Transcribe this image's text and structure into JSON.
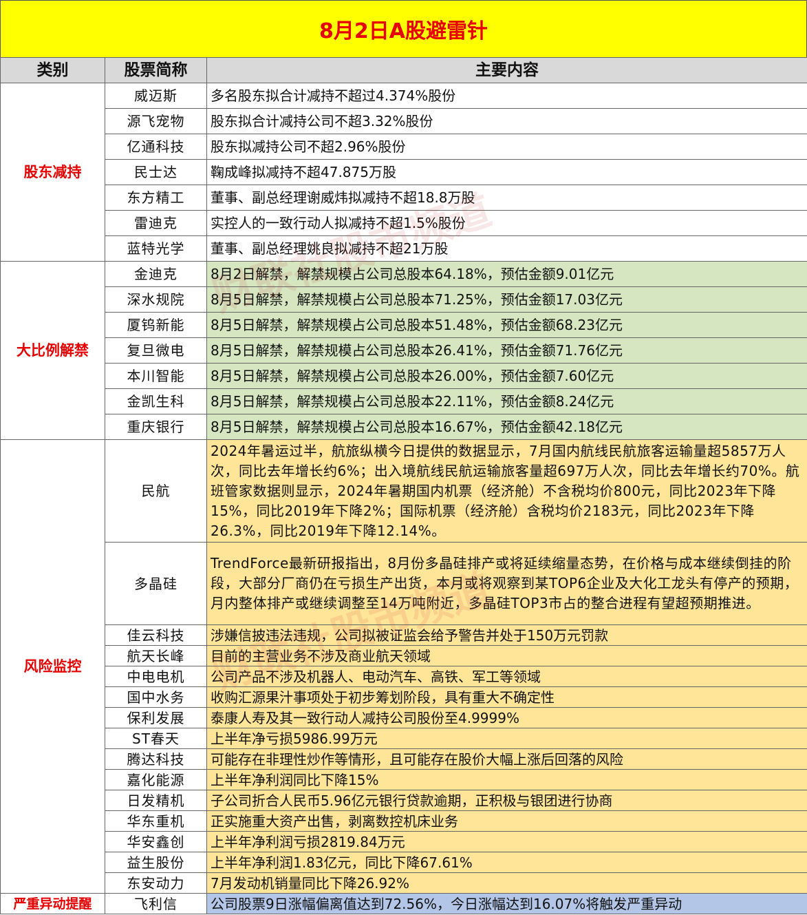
{
  "title": "8月2日A股避雷针",
  "headers": {
    "category": "类别",
    "stock": "股票简称",
    "content": "主要内容"
  },
  "watermark": "财联社股市频道",
  "sections": [
    {
      "category": "股东减持",
      "rows": [
        {
          "stock": "威迈斯",
          "content": "多名股东拟合计减持不超过4.374%股份"
        },
        {
          "stock": "源飞宠物",
          "content": "股东拟合计减持公司不超3.32%股份"
        },
        {
          "stock": "亿通科技",
          "content": "股东拟减持公司不超2.96%股份"
        },
        {
          "stock": "民士达",
          "content": "鞠成峰拟减持不超47.875万股"
        },
        {
          "stock": "东方精工",
          "content": "董事、副总经理谢威炜拟减持不超18.8万股"
        },
        {
          "stock": "雷迪克",
          "content": "实控人的一致行动人拟减持不超1.5%股份"
        },
        {
          "stock": "蓝特光学",
          "content": "董事、副总经理姚良拟减持不超21万股"
        }
      ]
    },
    {
      "category": "大比例解禁",
      "rows": [
        {
          "stock": "金迪克",
          "content": "8月2日解禁，解禁规模占公司总股本64.18%，预估金额9.01亿元"
        },
        {
          "stock": "深水规院",
          "content": "8月5日解禁，解禁规模占公司总股本71.25%，预估金额17.03亿元"
        },
        {
          "stock": "厦钨新能",
          "content": "8月5日解禁，解禁规模占公司总股本51.48%，预估金额68.23亿元"
        },
        {
          "stock": "复旦微电",
          "content": "8月5日解禁，解禁规模占公司总股本26.41%，预估金额71.76亿元"
        },
        {
          "stock": "本川智能",
          "content": "8月5日解禁，解禁规模占公司总股本26.00%，预估金额7.60亿元"
        },
        {
          "stock": "金凯生科",
          "content": "8月5日解禁，解禁规模占公司总股本22.11%，预估金额8.24亿元"
        },
        {
          "stock": "重庆银行",
          "content": "8月5日解禁，解禁规模占公司总股本16.67%，预估金额42.18亿元"
        }
      ]
    },
    {
      "category": "风险监控",
      "rows": [
        {
          "stock": "民航",
          "content": "2024年暑运过半，航旅纵横今日提供的数据显示，7月国内航线民航旅客运输量超5857万人次，同比去年增长约6%；出入境航线民航运输旅客量超697万人次，同比去年增长约70%。航班管家数据则显示，2024年暑期国内机票（经济舱）不含税均价800元，同比2023年下降15%，同比2019年下降2%；国际机票（经济舱）含税均价2183元，同比2023年下降26.3%，同比2019年下降12.14%。"
        },
        {
          "stock": "多晶硅",
          "content": "TrendForce最新研报指出，8月份多晶硅排产或将延续缩量态势，在价格与成本继续倒挂的阶段，大部分厂商仍在亏损生产出货，本月或将观察到某TOP6企业及大化工龙头有停产的预期，月内整体排产或继续调整至14万吨附近，多晶硅TOP3市占的整合进程有望超预期推进。"
        },
        {
          "stock": "佳云科技",
          "content": "涉嫌信披违法违规，公司拟被证监会给予警告并处于150万元罚款"
        },
        {
          "stock": "航天长峰",
          "content": "目前的主营业务不涉及商业航天领域"
        },
        {
          "stock": "中电电机",
          "content": "公司产品不涉及机器人、电动汽车、高铁、军工等领域"
        },
        {
          "stock": "国中水务",
          "content": "收购汇源果汁事项处于初步筹划阶段，具有重大不确定性"
        },
        {
          "stock": "保利发展",
          "content": "泰康人寿及其一致行动人减持公司股份至4.9999%"
        },
        {
          "stock": "ST春天",
          "content": "上半年净亏损5986.99万元"
        },
        {
          "stock": "腾达科技",
          "content": "可能存在非理性炒作等情形，且可能存在股价大幅上涨后回落的风险"
        },
        {
          "stock": "嘉化能源",
          "content": "上半年净利润同比下降15%"
        },
        {
          "stock": "日发精机",
          "content": "子公司折合人民币5.96亿元银行贷款逾期，正积极与银团进行协商"
        },
        {
          "stock": "华东重机",
          "content": "正实施重大资产出售，剥离数控机床业务"
        },
        {
          "stock": "华安鑫创",
          "content": "上半年净利润亏损2819.84万元"
        },
        {
          "stock": "益生股份",
          "content": "上半年净利润1.83亿元，同比下降67.61%"
        },
        {
          "stock": "东安动力",
          "content": "7月发动机销量同比下降26.92%"
        }
      ]
    },
    {
      "category": "严重异动提醒",
      "rows": [
        {
          "stock": "飞利信",
          "content": "公司股票9日涨幅偏离值达到72.56%，今日涨幅达到16.07%将触发严重异动"
        }
      ]
    }
  ],
  "colors": {
    "title_bg": "#ffff00",
    "title_text": "#e60000",
    "header_bg": "#d9d9d9",
    "category_text": "#e60000",
    "green_fill": "#d5e6c0",
    "yellow_fill": "#ffe598",
    "blue_fill": "#b4c6e8"
  }
}
